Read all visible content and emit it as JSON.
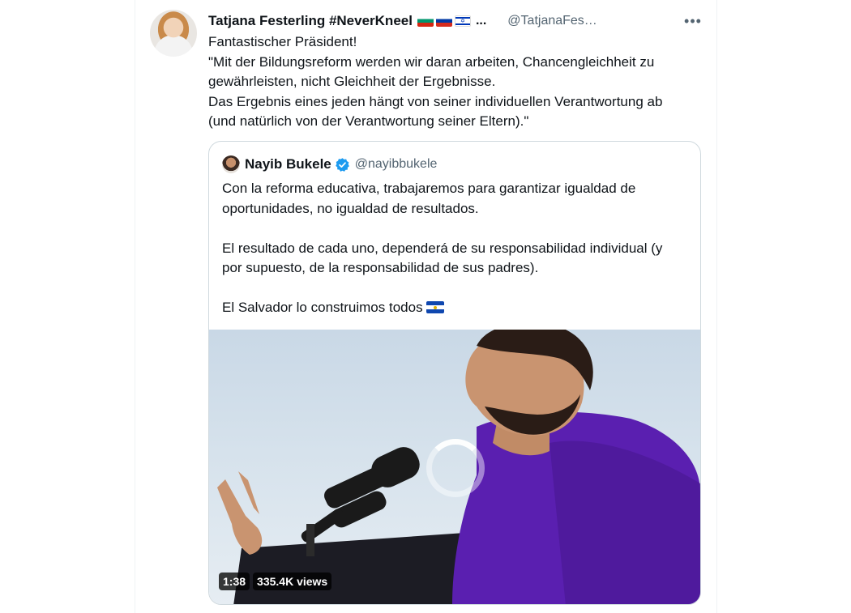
{
  "author": {
    "name": "Tatjana Festerling #NeverKneel",
    "flags": [
      "bulgaria-flag",
      "russia-flag",
      "israel-flag"
    ],
    "ellipsis": "...",
    "handle": "@TatjanaFes…"
  },
  "tweet_text": [
    "Fantastischer Präsident!",
    "\"Mit der Bildungsreform werden wir daran arbeiten, Chancengleichheit zu",
    "gewährleisten, nicht Gleichheit der Ergebnisse.",
    "Das Ergebnis eines jeden hängt von seiner individuellen Verantwortung ab",
    "(und natürlich von der Verantwortung seiner Eltern).\""
  ],
  "quoted": {
    "name": "Nayib Bukele",
    "handle": "@nayibbukele",
    "text": [
      "Con la reforma educativa, trabajaremos para garantizar igualdad de",
      "oportunidades, no igualdad de resultados.",
      "El resultado de cada uno, dependerá de su responsabilidad individual (y",
      "por supuesto, de la responsabilidad de sus padres).",
      "El Salvador lo construimos todos"
    ],
    "media": {
      "duration": "1:38",
      "views": "335.4K views"
    }
  },
  "colors": {
    "text": "#0f1419",
    "secondary": "#536471",
    "verified": "#1d9bf0",
    "border": "#cfd9de"
  }
}
